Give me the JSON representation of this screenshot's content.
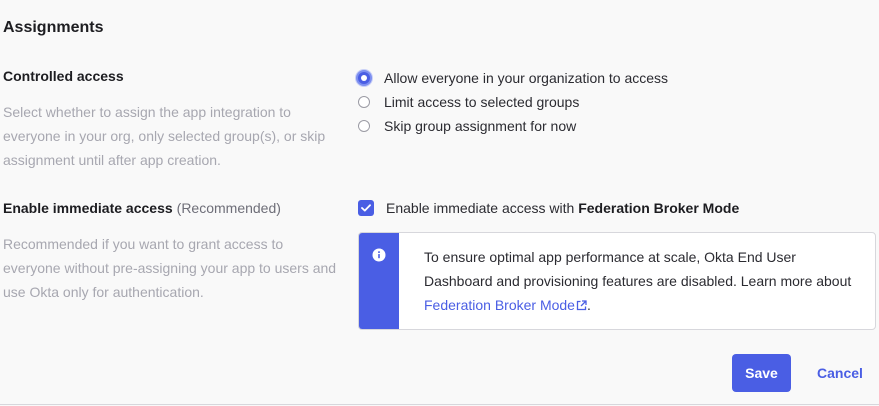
{
  "section": {
    "title": "Assignments"
  },
  "controlled_access": {
    "label": "Controlled access",
    "help": "Select whether to assign the app integration to everyone in your org, only selected group(s), or skip assignment until after app creation.",
    "options": [
      {
        "label": "Allow everyone in your organization to access",
        "checked": true
      },
      {
        "label": "Limit access to selected groups",
        "checked": false
      },
      {
        "label": "Skip group assignment for now",
        "checked": false
      }
    ]
  },
  "immediate_access": {
    "label": "Enable immediate access",
    "recommended": "(Recommended)",
    "help": "Recommended if you want to grant access to everyone without pre-assigning your app to users and use Okta only for authentication.",
    "checkbox_prefix": "Enable immediate access with ",
    "checkbox_bold": "Federation Broker Mode",
    "checked": true,
    "callout": {
      "text": "To ensure optimal app performance at scale, Okta End User Dashboard and provisioning features are disabled. Learn more about ",
      "link": "Federation Broker Mode",
      "suffix": ".",
      "icon": "info-icon",
      "link_icon": "external-link-icon"
    }
  },
  "actions": {
    "save": "Save",
    "cancel": "Cancel"
  },
  "colors": {
    "accent": "#4a5ee4",
    "help_text": "#a7a7b0"
  }
}
